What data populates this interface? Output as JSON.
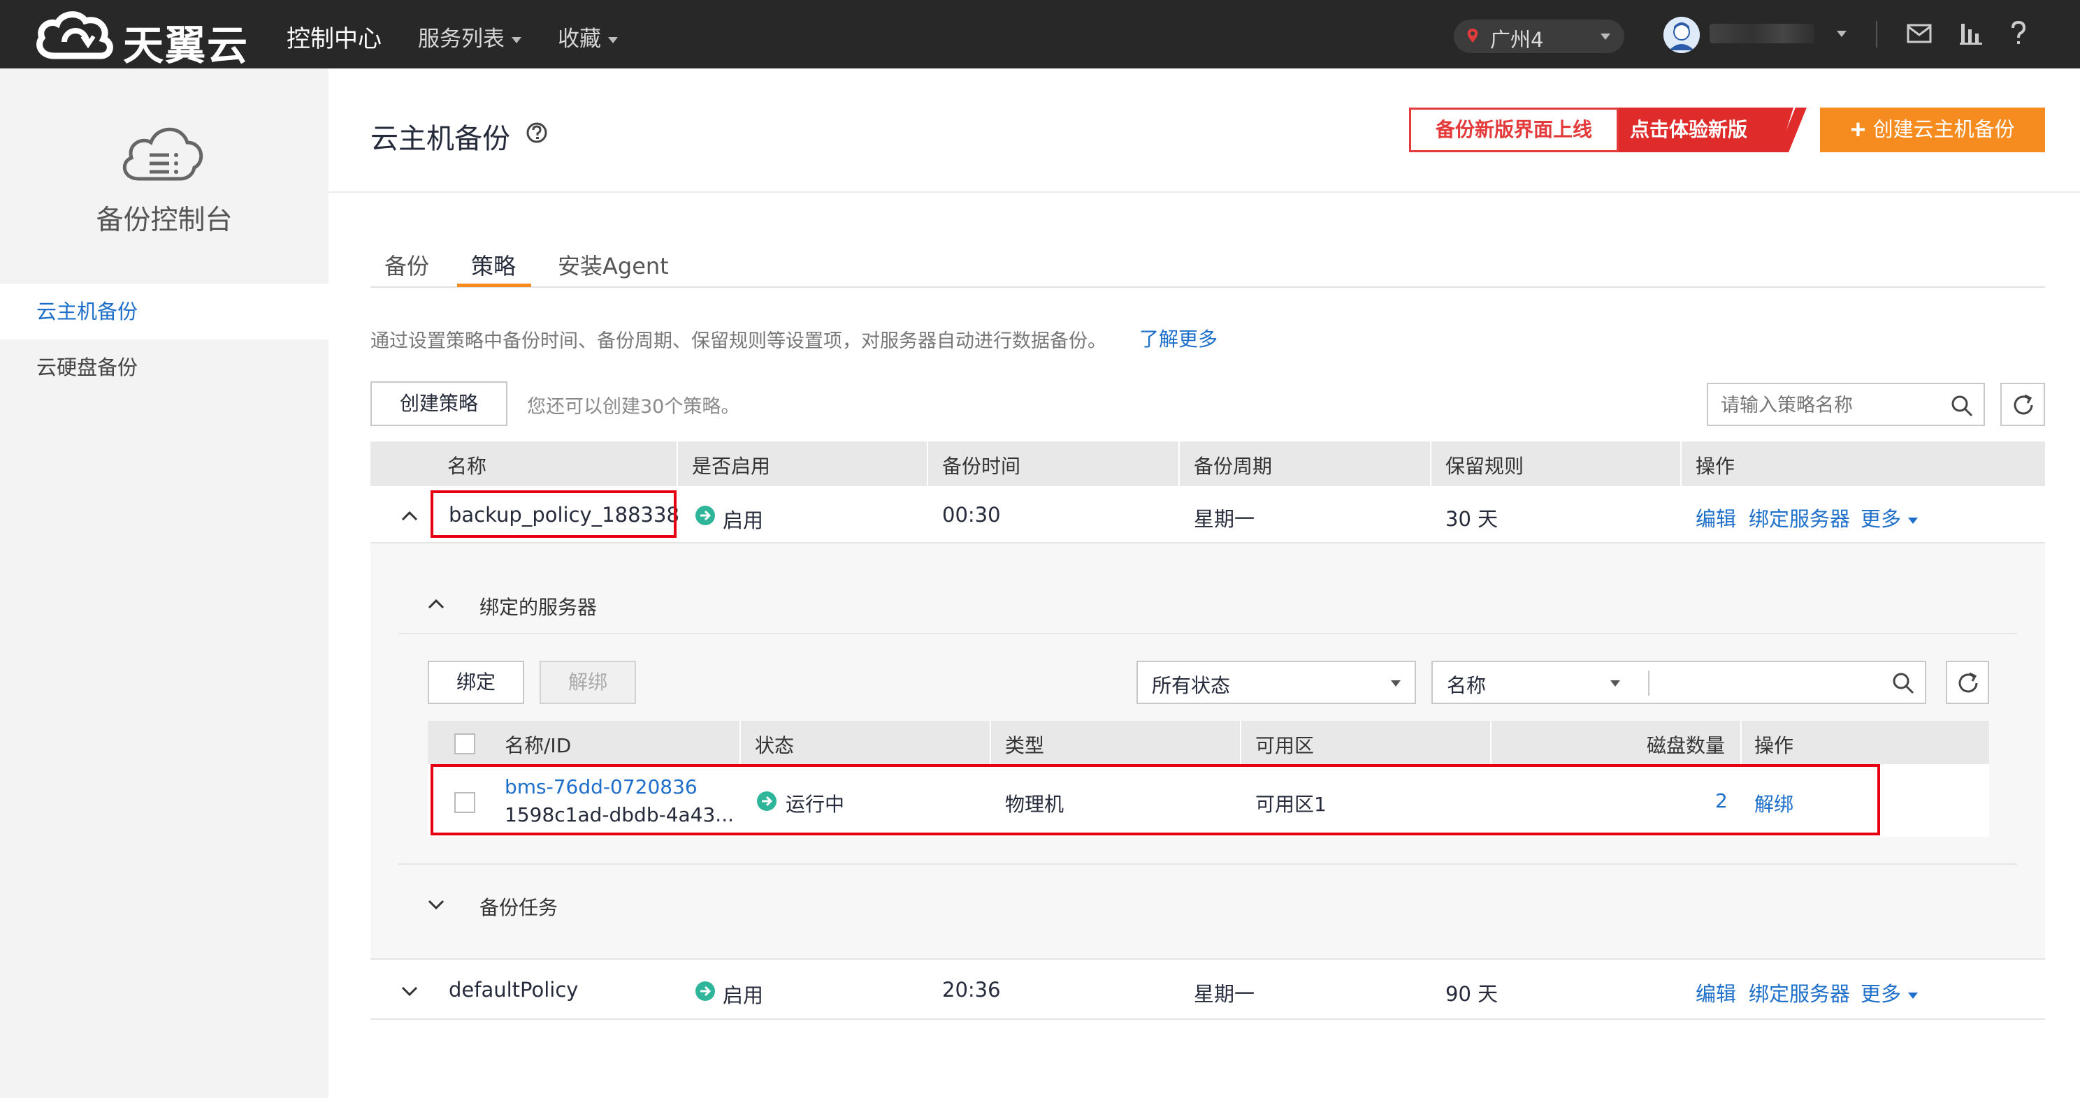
{
  "topbar": {
    "brand": "天翼云",
    "nav": [
      "控制中心",
      "服务列表",
      "收藏"
    ],
    "region": "广州4"
  },
  "sidebar": {
    "title": "备份控制台",
    "items": [
      {
        "label": "云主机备份",
        "active": true
      },
      {
        "label": "云硬盘备份",
        "active": false
      }
    ]
  },
  "header": {
    "title": "云主机备份",
    "promo_left": "备份新版界面上线",
    "promo_right": "点击体验新版",
    "create_button": "创建云主机备份"
  },
  "tabs": [
    {
      "label": "备份",
      "active": false
    },
    {
      "label": "策略",
      "active": true
    },
    {
      "label": "安装Agent",
      "active": false
    }
  ],
  "description": {
    "text": "通过设置策略中备份时间、备份周期、保留规则等设置项，对服务器自动进行数据备份。",
    "link": "了解更多"
  },
  "toolbar": {
    "create_policy": "创建策略",
    "quota_text": "您还可以创建30个策略。",
    "search_placeholder": "请输入策略名称"
  },
  "table": {
    "columns": [
      "名称",
      "是否启用",
      "备份时间",
      "备份周期",
      "保留规则",
      "操作"
    ],
    "rows": [
      {
        "name": "backup_policy_188338",
        "enabled": "启用",
        "time": "00:30",
        "cycle": "星期一",
        "retention": "30 天",
        "actions": [
          "编辑",
          "绑定服务器",
          "更多"
        ]
      },
      {
        "name": "defaultPolicy",
        "enabled": "启用",
        "time": "20:36",
        "cycle": "星期一",
        "retention": "90 天",
        "actions": [
          "编辑",
          "绑定服务器",
          "更多"
        ]
      }
    ]
  },
  "bound_servers": {
    "section_title": "绑定的服务器",
    "bind_button": "绑定",
    "unbind_button": "解绑",
    "status_filter": "所有状态",
    "field_filter": "名称",
    "columns": [
      "名称/ID",
      "状态",
      "类型",
      "可用区",
      "磁盘数量",
      "操作"
    ],
    "rows": [
      {
        "name": "bms-76dd-0720836",
        "id": "1598c1ad-dbdb-4a43...",
        "status": "运行中",
        "type": "物理机",
        "zone": "可用区1",
        "disks": "2",
        "action": "解绑"
      }
    ]
  },
  "backup_tasks": {
    "section_title": "备份任务"
  },
  "colors": {
    "topbar": "#282828",
    "accent": "#f68b1f",
    "link": "#1e6fca",
    "status_green": "#2fb59a",
    "highlight_red": "#e60012"
  }
}
